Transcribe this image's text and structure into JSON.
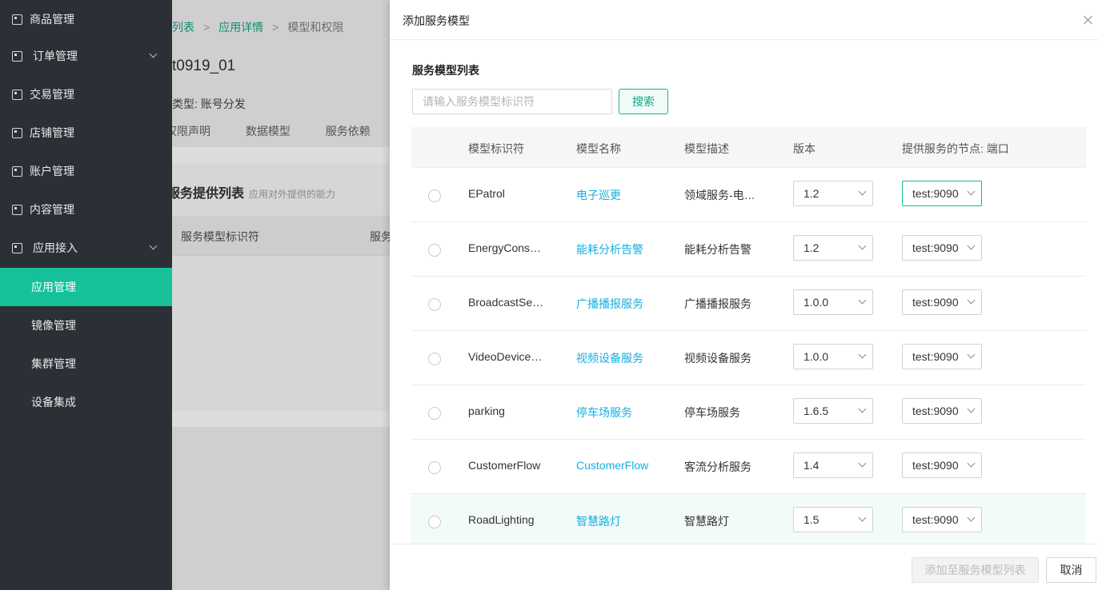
{
  "sidebar": {
    "items": [
      {
        "label": "商品管理",
        "icon": "grid-icon"
      },
      {
        "label": "订单管理",
        "icon": "list-icon",
        "caret": true
      },
      {
        "label": "交易管理",
        "icon": "transaction-icon"
      },
      {
        "label": "店铺管理",
        "icon": "store-icon"
      },
      {
        "label": "账户管理",
        "icon": "account-icon"
      },
      {
        "label": "内容管理",
        "icon": "content-icon"
      },
      {
        "label": "应用接入",
        "icon": "app-access-icon",
        "caret": true
      }
    ],
    "subitems": [
      {
        "label": "应用管理",
        "active": true
      },
      {
        "label": "镜像管理"
      },
      {
        "label": "集群管理"
      },
      {
        "label": "设备集成"
      }
    ]
  },
  "background_page": {
    "breadcrumb": [
      "列表",
      "应用详情",
      "模型和权限"
    ],
    "title": "t0919_01",
    "type_label": "类型: 账号分发",
    "tabs": [
      "权限声明",
      "数据模型",
      "服务依赖"
    ],
    "card_title": "服务提供列表",
    "card_subtitle": "应用对外提供的能力",
    "table_headers": [
      "服务模型标识符",
      "服务"
    ]
  },
  "drawer": {
    "title": "添加服务模型",
    "section_title": "服务模型列表",
    "search": {
      "placeholder": "请输入服务模型标识符",
      "value": "",
      "button": "搜索"
    },
    "columns": [
      "模型标识符",
      "模型名称",
      "模型描述",
      "版本",
      "提供服务的节点: 端口"
    ],
    "rows": [
      {
        "id": "EPatrol",
        "name": "电子巡更",
        "desc": "领域服务-电子巡更",
        "version": "1.2",
        "node": "test:9090"
      },
      {
        "id": "EnergyConsumption",
        "name": "能耗分析告警",
        "desc": "能耗分析告警",
        "version": "1.2",
        "node": "test:9090"
      },
      {
        "id": "BroadcastService",
        "name": "广播播报服务",
        "desc": "广播播报服务",
        "version": "1.0.0",
        "node": "test:9090"
      },
      {
        "id": "VideoDeviceService",
        "name": "视频设备服务",
        "desc": "视频设备服务",
        "version": "1.0.0",
        "node": "test:9090"
      },
      {
        "id": "parking",
        "name": "停车场服务",
        "desc": "停车场服务",
        "version": "1.6.5",
        "node": "test:9090"
      },
      {
        "id": "CustomerFlow",
        "name": "CustomerFlow",
        "desc": "客流分析服务",
        "version": "1.4",
        "node": "test:9090"
      },
      {
        "id": "RoadLighting",
        "name": "智慧路灯",
        "desc": "智慧路灯",
        "version": "1.5",
        "node": "test:9090"
      }
    ],
    "footer": {
      "add_button": "添加至服务模型列表",
      "cancel_button": "取消"
    }
  },
  "colors": {
    "accent": "#16c19a",
    "link": "#16aee0",
    "sidebar_bg": "#2b2f36"
  }
}
